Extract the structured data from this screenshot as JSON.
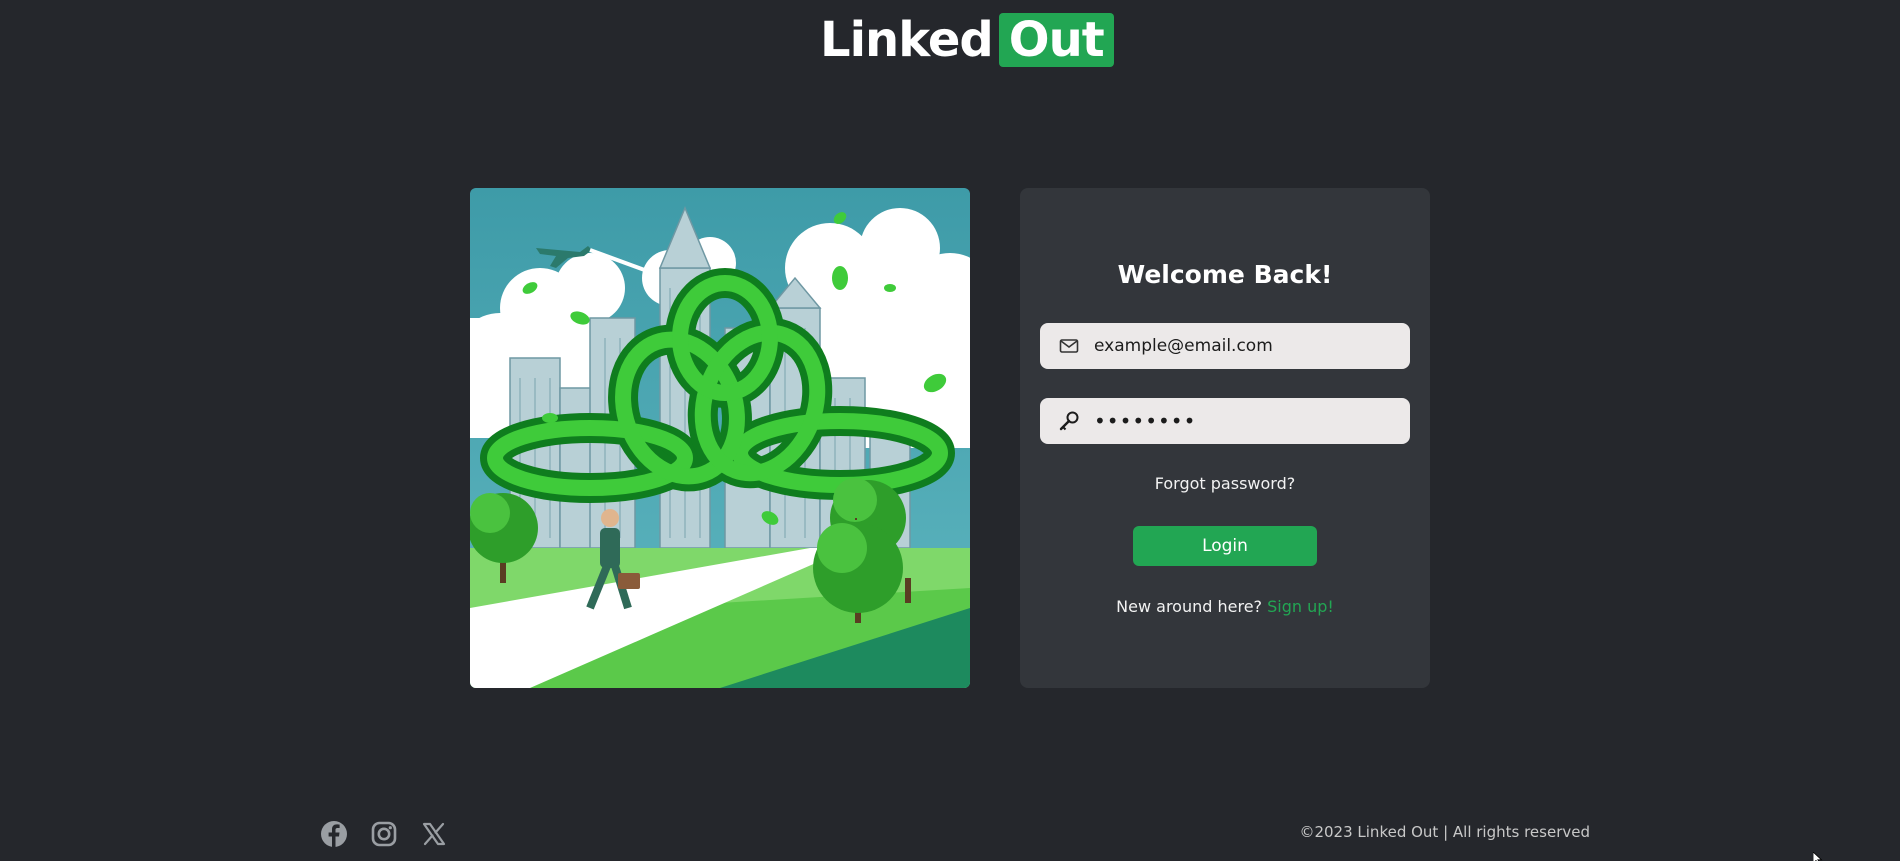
{
  "logo": {
    "part1": "Linked",
    "part2": "Out"
  },
  "illustration": {
    "name": "linked-chains-city-illustration"
  },
  "login": {
    "title": "Welcome Back!",
    "email_value": "example@email.com",
    "email_icon": "envelope-icon",
    "password_value": "••••••••",
    "password_icon": "key-icon",
    "forgot_label": "Forgot password?",
    "login_label": "Login",
    "signup_prompt": "New around here?",
    "signup_label": "Sign up!"
  },
  "footer": {
    "social_icons": [
      "facebook-icon",
      "instagram-icon",
      "x-icon"
    ],
    "copyright": "©2023 Linked Out | All rights reserved"
  },
  "colors": {
    "background": "#25272c",
    "card": "#33363b",
    "accent": "#22a653",
    "input": "#ece9e9"
  }
}
